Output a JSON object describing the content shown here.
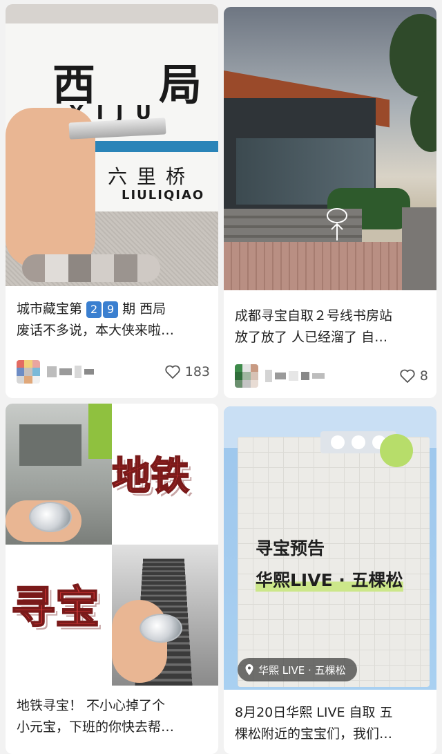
{
  "feed": {
    "cards": [
      {
        "title": "城市藏宝第 2 9 期 西局废话不多说，本大侠来啦…",
        "title_parts": {
          "before": "城市藏宝第 ",
          "digit1": "2",
          "digit2": "9",
          "after": " 期 西局",
          "line2": "废话不多说，本大侠来啦…"
        },
        "image": {
          "sign_char_1": "西",
          "sign_char_2": "局",
          "sign_latin": "XIJU",
          "next_station": "六里桥",
          "next_station_latin": "LIULIQIAO"
        },
        "likes": "183",
        "accent": "#3a7fd0"
      },
      {
        "title_line1": "成都寻宝自取２号线书房站",
        "title_line2": "放了放了 人已经溜了 自…",
        "likes": "8"
      },
      {
        "image": {
          "sticker_1": "地铁",
          "sticker_2": "寻宝"
        },
        "title_line1": "地铁寻宝！ 不小心掉了个",
        "title_line2": "小元宝，下班的你快去帮…"
      },
      {
        "image": {
          "headline": "寻宝预告",
          "subheadline": "华熙LIVE · 五棵松",
          "location": "华熙 LIVE · 五棵松"
        },
        "title_line1": "8月20日华熙 LIVE 自取 五",
        "title_line2": "棵松附近的宝宝们，我们…"
      }
    ]
  },
  "icons": {
    "heart": "heart-icon",
    "location": "location-pin-icon"
  },
  "colors": {
    "sign_stripe": "#2a84b8",
    "sticker_red": "#e33b3b",
    "poster_highlight": "#cce78a",
    "digit_badge": "#3a7fd0"
  }
}
